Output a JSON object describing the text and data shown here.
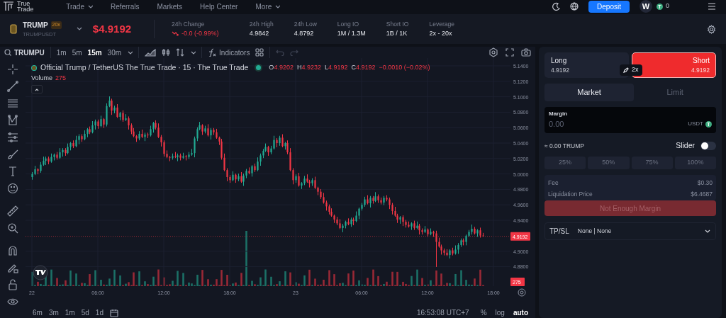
{
  "top_nav": {
    "logo_lines": [
      "True",
      "Trade"
    ],
    "items": [
      {
        "label": "Trade",
        "dropdown": true
      },
      {
        "label": "Referrals",
        "dropdown": false
      },
      {
        "label": "Markets",
        "dropdown": false
      },
      {
        "label": "Help Center",
        "dropdown": false
      },
      {
        "label": "More",
        "dropdown": true
      }
    ],
    "deposit": "Deposit",
    "avatar": "W",
    "balance": {
      "token": "T",
      "amount": "0"
    }
  },
  "ticker": {
    "symbol": "TRUMP",
    "leverage_badge": "20x",
    "pair": "TRUMPUSDT",
    "price": "$4.9192",
    "stats": [
      {
        "label": "24h Change",
        "value": "-0.0 (-0.99%)",
        "kind": "falling"
      },
      {
        "label": "24h High",
        "value": "4.9842",
        "kind": "plain"
      },
      {
        "label": "24h Low",
        "value": "4.8792",
        "kind": "plain"
      },
      {
        "label": "Long IO",
        "value": "1M / 1.3M",
        "kind": "plain"
      },
      {
        "label": "Short IO",
        "value": "1B / 1K",
        "kind": "plain"
      },
      {
        "label": "Leverage",
        "value": "2x - 20x",
        "kind": "plain"
      }
    ]
  },
  "chart_toolbar": {
    "symbol": "TRUMPU",
    "intervals": [
      {
        "label": "1m",
        "selected": false
      },
      {
        "label": "5m",
        "selected": false
      },
      {
        "label": "15m",
        "selected": true
      },
      {
        "label": "30m",
        "selected": false
      }
    ],
    "indicators": "Indicators"
  },
  "chart": {
    "title": "Official Trump / TetherUS The True Trade · 15 · The True Trade",
    "ohlc": [
      {
        "key": "O",
        "value": "4.9202"
      },
      {
        "key": "H",
        "value": "4.9232"
      },
      {
        "key": "L",
        "value": "4.9192"
      },
      {
        "key": "C",
        "value": "4.9192"
      }
    ],
    "change": "−0.0010 (−0.02%)",
    "volume_label": "Volume",
    "volume_value": "275",
    "chart_data": {
      "type": "candlestick",
      "grid": true,
      "ylim": [
        4.8547,
        5.1501
      ],
      "yticks": [
        {
          "value": 5.14,
          "label": "5.1400"
        },
        {
          "value": 5.12,
          "label": "5.1200"
        },
        {
          "value": 5.1,
          "label": "5.1000"
        },
        {
          "value": 5.08,
          "label": "5.0800"
        },
        {
          "value": 5.06,
          "label": "5.0600"
        },
        {
          "value": 5.04,
          "label": "5.0400"
        },
        {
          "value": 5.02,
          "label": "5.0200"
        },
        {
          "value": 5.0,
          "label": "5.0000"
        },
        {
          "value": 4.98,
          "label": "4.9800"
        },
        {
          "value": 4.96,
          "label": "4.9600"
        },
        {
          "value": 4.94,
          "label": "4.9400"
        },
        {
          "value": 4.9,
          "label": "4.9000"
        },
        {
          "value": 4.88,
          "label": "4.8800"
        }
      ],
      "categories": [
        "22",
        null,
        null,
        null,
        null,
        null,
        null,
        null,
        null,
        null,
        null,
        null,
        null,
        null,
        null,
        null,
        null,
        null,
        null,
        null,
        null,
        null,
        null,
        null,
        "06:00",
        null,
        null,
        null,
        null,
        null,
        null,
        null,
        null,
        null,
        null,
        null,
        null,
        null,
        null,
        null,
        null,
        null,
        null,
        null,
        null,
        null,
        null,
        null,
        "12:00",
        null,
        null,
        null,
        null,
        null,
        null,
        null,
        null,
        null,
        null,
        null,
        null,
        null,
        null,
        null,
        null,
        null,
        null,
        null,
        null,
        null,
        null,
        null,
        "18:00",
        null,
        null,
        null,
        null,
        null,
        null,
        null,
        null,
        null,
        null,
        null,
        null,
        null,
        null,
        null,
        null,
        null,
        null,
        null,
        null,
        null,
        null,
        null,
        "23",
        null,
        null,
        null,
        null,
        null,
        null,
        null,
        null,
        null,
        null,
        null,
        null,
        null,
        null,
        null,
        null,
        null,
        null,
        null,
        null,
        null,
        null,
        null,
        "06:00",
        null,
        null,
        null,
        null,
        null,
        null,
        null,
        null,
        null,
        null,
        null,
        null,
        null,
        null,
        null,
        null,
        null,
        null,
        null,
        null,
        null,
        null,
        null,
        "12:00",
        null,
        null,
        null,
        null,
        null,
        null,
        null,
        null,
        null,
        null,
        null,
        null,
        null,
        null,
        null,
        null,
        null,
        null,
        null,
        null,
        null,
        null,
        null,
        "18:00",
        null,
        null,
        null,
        null,
        null,
        null
      ],
      "ohlc": [
        [
          4.996,
          5.002,
          4.993,
          5.0
        ],
        [
          5.0,
          5.01,
          4.999,
          5.006
        ],
        [
          5.006,
          5.007,
          5.0,
          5.004
        ],
        [
          5.004,
          5.015,
          5.002,
          5.012
        ],
        [
          5.012,
          5.022,
          5.011,
          5.017
        ],
        [
          5.017,
          5.022,
          5.012,
          5.02
        ],
        [
          5.02,
          5.022,
          5.013,
          5.016
        ],
        [
          5.016,
          5.026,
          5.015,
          5.022
        ],
        [
          5.022,
          5.026,
          5.018,
          5.025
        ],
        [
          5.025,
          5.028,
          5.019,
          5.021
        ],
        [
          5.021,
          5.033,
          5.02,
          5.028
        ],
        [
          5.028,
          5.033,
          5.023,
          5.031
        ],
        [
          5.031,
          5.033,
          5.024,
          5.027
        ],
        [
          5.027,
          5.039,
          5.026,
          5.035
        ],
        [
          5.035,
          5.041,
          5.031,
          5.04
        ],
        [
          5.04,
          5.043,
          5.034,
          5.036
        ],
        [
          5.036,
          5.049,
          5.035,
          5.044
        ],
        [
          5.044,
          5.051,
          5.039,
          5.049
        ],
        [
          5.049,
          5.051,
          5.042,
          5.045
        ],
        [
          5.045,
          5.056,
          5.044,
          5.052
        ],
        [
          5.052,
          5.059,
          5.048,
          5.058
        ],
        [
          5.058,
          5.061,
          5.052,
          5.054
        ],
        [
          5.054,
          5.068,
          5.053,
          5.063
        ],
        [
          5.063,
          5.07,
          5.058,
          5.068
        ],
        [
          5.068,
          5.07,
          5.059,
          5.062
        ],
        [
          5.062,
          5.075,
          5.061,
          5.071
        ],
        [
          5.071,
          5.072,
          5.06,
          5.064
        ],
        [
          5.064,
          5.091,
          5.062,
          5.088
        ],
        [
          5.088,
          5.1,
          5.087,
          5.095
        ],
        [
          5.095,
          5.097,
          5.077,
          5.082
        ],
        [
          5.082,
          5.088,
          5.079,
          5.086
        ],
        [
          5.086,
          5.09,
          5.073,
          5.074
        ],
        [
          5.074,
          5.08,
          5.07,
          5.079
        ],
        [
          5.079,
          5.082,
          5.068,
          5.07
        ],
        [
          5.07,
          5.077,
          5.069,
          5.072
        ],
        [
          5.072,
          5.074,
          5.058,
          5.063
        ],
        [
          5.063,
          5.065,
          5.052,
          5.055
        ],
        [
          5.055,
          5.059,
          5.048,
          5.049
        ],
        [
          5.049,
          5.05,
          5.042,
          5.046
        ],
        [
          5.046,
          5.055,
          5.044,
          5.052
        ],
        [
          5.052,
          5.057,
          5.047,
          5.048
        ],
        [
          5.048,
          5.053,
          5.043,
          5.051
        ],
        [
          5.051,
          5.053,
          5.047,
          5.05
        ],
        [
          5.05,
          5.062,
          5.049,
          5.058
        ],
        [
          5.058,
          5.067,
          5.054,
          5.066
        ],
        [
          5.066,
          5.069,
          5.058,
          5.06
        ],
        [
          5.06,
          5.065,
          5.047,
          5.048
        ],
        [
          5.048,
          5.05,
          5.036,
          5.041
        ],
        [
          5.041,
          5.043,
          5.023,
          5.026
        ],
        [
          5.026,
          5.03,
          5.021,
          5.022
        ],
        [
          5.022,
          5.023,
          5.017,
          5.021
        ],
        [
          5.021,
          5.026,
          5.019,
          5.023
        ],
        [
          5.023,
          5.028,
          5.021,
          5.022
        ],
        [
          5.022,
          5.026,
          5.017,
          5.024
        ],
        [
          5.024,
          5.026,
          5.018,
          5.021
        ],
        [
          5.021,
          5.027,
          5.02,
          5.023
        ],
        [
          5.023,
          5.024,
          5.018,
          5.022
        ],
        [
          5.022,
          5.028,
          5.02,
          5.025
        ],
        [
          5.025,
          5.032,
          5.024,
          5.027
        ],
        [
          5.027,
          5.048,
          5.022,
          5.046
        ],
        [
          5.046,
          5.06,
          5.043,
          5.058
        ],
        [
          5.058,
          5.067,
          5.057,
          5.063
        ],
        [
          5.063,
          5.064,
          5.051,
          5.055
        ],
        [
          5.055,
          5.062,
          5.053,
          5.059
        ],
        [
          5.059,
          5.064,
          5.049,
          5.05
        ],
        [
          5.05,
          5.059,
          5.045,
          5.057
        ],
        [
          5.057,
          5.059,
          5.051,
          5.054
        ],
        [
          5.054,
          5.058,
          5.046,
          5.047
        ],
        [
          5.047,
          5.048,
          5.038,
          5.042
        ],
        [
          5.042,
          5.045,
          5.019,
          5.021
        ],
        [
          5.021,
          5.026,
          5.004,
          5.005
        ],
        [
          5.005,
          5.007,
          4.991,
          4.996
        ],
        [
          4.996,
          4.998,
          4.989,
          4.992
        ],
        [
          4.992,
          5.003,
          4.991,
          4.999
        ],
        [
          4.999,
          5.0,
          4.989,
          4.993
        ],
        [
          4.993,
          5.0,
          4.991,
          4.997
        ],
        [
          4.997,
          5.002,
          4.989,
          4.99
        ],
        [
          4.99,
          5.0,
          4.985,
          4.998
        ],
        [
          4.998,
          5.006,
          4.995,
          5.004
        ],
        [
          5.004,
          5.008,
          5.0,
          5.001
        ],
        [
          5.001,
          5.011,
          4.997,
          5.01
        ],
        [
          5.01,
          5.013,
          5.003,
          5.005
        ],
        [
          5.005,
          5.021,
          5.004,
          5.016
        ],
        [
          5.016,
          5.026,
          5.011,
          5.024
        ],
        [
          5.024,
          5.032,
          5.021,
          5.03
        ],
        [
          5.03,
          5.039,
          5.029,
          5.035
        ],
        [
          5.035,
          5.036,
          5.024,
          5.028
        ],
        [
          5.028,
          5.036,
          5.026,
          5.033
        ],
        [
          5.033,
          5.049,
          5.032,
          5.044
        ],
        [
          5.044,
          5.046,
          5.035,
          5.04
        ],
        [
          5.04,
          5.049,
          5.037,
          5.047
        ],
        [
          5.047,
          5.051,
          5.035,
          5.036
        ],
        [
          5.036,
          5.041,
          5.032,
          5.04
        ],
        [
          5.04,
          5.043,
          5.026,
          5.028
        ],
        [
          5.028,
          5.033,
          5.004,
          5.005
        ],
        [
          5.005,
          5.007,
          4.987,
          4.992
        ],
        [
          4.992,
          4.999,
          4.989,
          4.997
        ],
        [
          4.997,
          5.001,
          4.984,
          4.985
        ],
        [
          4.985,
          4.989,
          4.981,
          4.988
        ],
        [
          4.988,
          4.997,
          4.986,
          4.994
        ],
        [
          4.994,
          4.999,
          4.989,
          4.99
        ],
        [
          4.99,
          4.992,
          4.983,
          4.988
        ],
        [
          4.988,
          4.994,
          4.985,
          4.992
        ],
        [
          4.992,
          4.996,
          4.981,
          4.982
        ],
        [
          4.982,
          4.983,
          4.973,
          4.977
        ],
        [
          4.977,
          4.98,
          4.968,
          4.97
        ],
        [
          4.97,
          4.975,
          4.962,
          4.963
        ],
        [
          4.963,
          4.965,
          4.953,
          4.958
        ],
        [
          4.958,
          4.96,
          4.948,
          4.951
        ],
        [
          4.951,
          4.955,
          4.945,
          4.946
        ],
        [
          4.946,
          4.947,
          4.937,
          4.941
        ],
        [
          4.941,
          4.944,
          4.934,
          4.936
        ],
        [
          4.936,
          4.941,
          4.929,
          4.93
        ],
        [
          4.93,
          4.935,
          4.925,
          4.933
        ],
        [
          4.933,
          4.939,
          4.93,
          4.938
        ],
        [
          4.938,
          4.942,
          4.934,
          4.935
        ],
        [
          4.935,
          4.943,
          4.932,
          4.941
        ],
        [
          4.941,
          4.943,
          4.934,
          4.939
        ],
        [
          4.939,
          4.951,
          4.938,
          4.946
        ],
        [
          4.946,
          4.956,
          4.942,
          4.955
        ],
        [
          4.955,
          4.962,
          4.953,
          4.96
        ],
        [
          4.96,
          4.97,
          4.958,
          4.967
        ],
        [
          4.967,
          4.972,
          4.961,
          4.962
        ],
        [
          4.962,
          4.971,
          4.957,
          4.969
        ],
        [
          4.969,
          4.971,
          4.962,
          4.965
        ],
        [
          4.965,
          4.976,
          4.964,
          4.971
        ],
        [
          4.971,
          4.973,
          4.963,
          4.966
        ],
        [
          4.966,
          4.969,
          4.961,
          4.963
        ],
        [
          4.963,
          4.971,
          4.96,
          4.969
        ],
        [
          4.969,
          4.972,
          4.965,
          4.967
        ],
        [
          4.967,
          4.969,
          4.955,
          4.96
        ],
        [
          4.96,
          4.962,
          4.948,
          4.952
        ],
        [
          4.952,
          4.957,
          4.945,
          4.946
        ],
        [
          4.946,
          4.948,
          4.937,
          4.941
        ],
        [
          4.941,
          4.945,
          4.936,
          4.944
        ],
        [
          4.944,
          4.946,
          4.933,
          4.938
        ],
        [
          4.938,
          4.94,
          4.931,
          4.934
        ],
        [
          4.934,
          4.938,
          4.931,
          4.932
        ],
        [
          4.932,
          4.937,
          4.928,
          4.936
        ],
        [
          4.936,
          4.939,
          4.928,
          4.93
        ],
        [
          4.93,
          4.938,
          4.929,
          4.933
        ],
        [
          4.933,
          4.935,
          4.922,
          4.927
        ],
        [
          4.927,
          4.929,
          4.922,
          4.925
        ],
        [
          4.925,
          4.932,
          4.924,
          4.928
        ],
        [
          4.928,
          4.929,
          4.919,
          4.922
        ],
        [
          4.922,
          4.929,
          4.921,
          4.925
        ],
        [
          4.925,
          4.926,
          4.919,
          4.923
        ],
        [
          4.923,
          4.926,
          4.88,
          4.912
        ],
        [
          4.912,
          4.917,
          4.905,
          4.906
        ],
        [
          4.906,
          4.908,
          4.896,
          4.901
        ],
        [
          4.901,
          4.903,
          4.895,
          4.898
        ],
        [
          4.898,
          4.902,
          4.894,
          4.895
        ],
        [
          4.895,
          4.902,
          4.891,
          4.901
        ],
        [
          4.901,
          4.904,
          4.895,
          4.897
        ],
        [
          4.897,
          4.907,
          4.896,
          4.902
        ],
        [
          4.902,
          4.91,
          4.897,
          4.908
        ],
        [
          4.908,
          4.916,
          4.906,
          4.914
        ],
        [
          4.914,
          4.916,
          4.908,
          4.912
        ],
        [
          4.912,
          4.921,
          4.908,
          4.92
        ],
        [
          4.92,
          4.927,
          4.919,
          4.925
        ],
        [
          4.925,
          4.934,
          4.922,
          4.929
        ],
        [
          4.929,
          4.931,
          4.922,
          4.923
        ],
        [
          4.923,
          4.928,
          4.919,
          4.927
        ],
        [
          4.927,
          4.93,
          4.918,
          4.9202
        ],
        [
          4.9202,
          4.9232,
          4.9192,
          4.9192
        ],
        null,
        null,
        null,
        null,
        null,
        null,
        null,
        null,
        null,
        null
      ]
    },
    "last_price": "4.9192",
    "last_volume": "275"
  },
  "chart_footer": {
    "ranges": [
      "6m",
      "3m",
      "1m",
      "5d",
      "1d"
    ],
    "clock": "16:53:08 UTC+7",
    "scale_options": [
      {
        "label": "%",
        "selected": false
      },
      {
        "label": "log",
        "selected": false
      },
      {
        "label": "auto",
        "selected": true
      }
    ]
  },
  "order_panel": {
    "sides": [
      {
        "label": "Long",
        "price": "4.9192",
        "selected": false
      },
      {
        "label": "Short",
        "price": "4.9192",
        "selected": true
      }
    ],
    "leverage": "2x",
    "order_types": [
      {
        "label": "Market",
        "selected": true
      },
      {
        "label": "Limit",
        "selected": false
      }
    ],
    "margin": {
      "label": "Margin",
      "placeholder": "0.00",
      "unit": "USDT",
      "token": "T"
    },
    "estimate": "≈ 0.00 TRUMP",
    "slider_toggle": {
      "label": "Slider",
      "on": false
    },
    "percent_buttons": [
      "25%",
      "50%",
      "75%",
      "100%"
    ],
    "summary": [
      {
        "label": "Fee",
        "value": "$0.30"
      },
      {
        "label": "Liquidation Price",
        "value": "$6.4687"
      }
    ],
    "submit": {
      "label": "Not Enough Margin",
      "disabled": true
    },
    "tpsl": {
      "label": "TP/SL",
      "value": "None | None"
    }
  }
}
